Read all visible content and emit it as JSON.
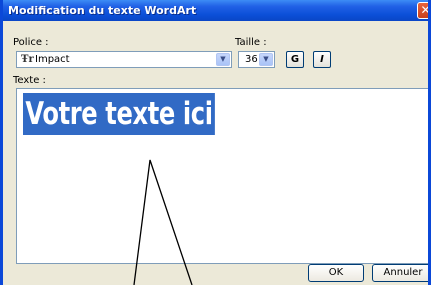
{
  "dialog": {
    "title": "Modification du texte WordArt",
    "close_label": "✕"
  },
  "font": {
    "label": "Police :",
    "value": "Impact",
    "glyph": "Ŧr"
  },
  "size": {
    "label": "Taille :",
    "value": "36"
  },
  "format": {
    "bold_label": "G",
    "italic_label": "I"
  },
  "text": {
    "label": "Texte :",
    "value": "Votre texte ici"
  },
  "buttons": {
    "ok": "OK",
    "cancel": "Annuler"
  },
  "colors": {
    "titlebar": "#0b4fd8",
    "selection": "#316ac5",
    "dialog_bg": "#ece9d8"
  },
  "icons": {
    "close": "close-icon",
    "font_type": "truetype-font-icon",
    "dropdown": "chevron-down-icon"
  }
}
